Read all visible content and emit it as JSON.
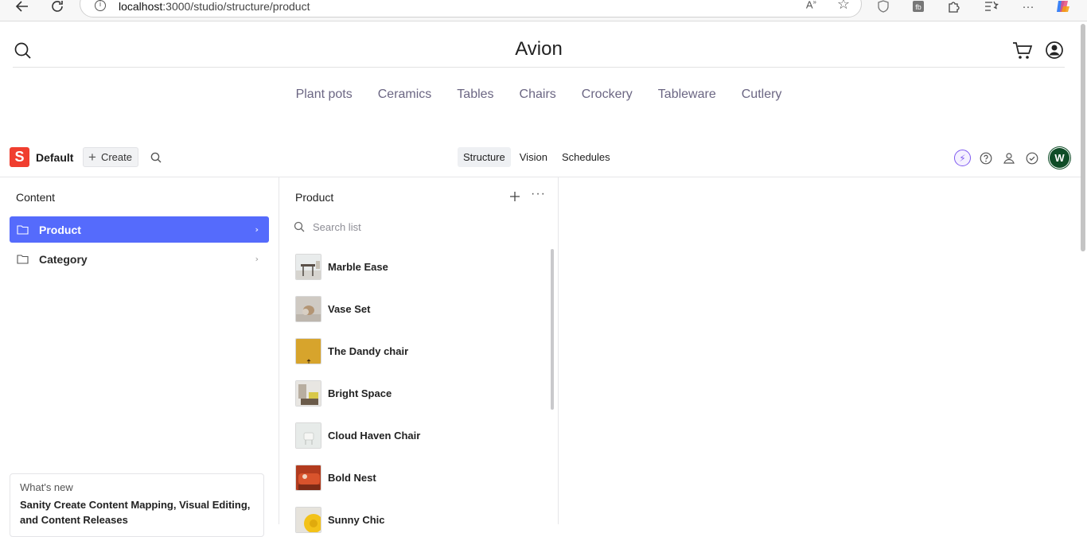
{
  "browser": {
    "url_host": "localhost",
    "url_rest": ":3000/studio/structure/product"
  },
  "site": {
    "title": "Avion",
    "categories": [
      "Plant pots",
      "Ceramics",
      "Tables",
      "Chairs",
      "Crockery",
      "Tableware",
      "Cutlery"
    ]
  },
  "studio": {
    "logo_letter": "S",
    "workspace": "Default",
    "create_label": "Create",
    "tools": [
      "Structure",
      "Vision",
      "Schedules"
    ],
    "active_tool": "Structure",
    "avatar_initial": "W",
    "colors": {
      "accent": "#556bfc",
      "brand": "#f03e2f",
      "avatar": "#0f4c27"
    }
  },
  "content_pane": {
    "title": "Content",
    "items": [
      {
        "label": "Product",
        "selected": true
      },
      {
        "label": "Category",
        "selected": false
      }
    ]
  },
  "whats_new": {
    "title": "What's new",
    "body": "Sanity Create Content Mapping, Visual Editing, and Content Releases"
  },
  "product_pane": {
    "title": "Product",
    "search_placeholder": "Search list",
    "items": [
      {
        "label": "Marble Ease",
        "thumb": "marble"
      },
      {
        "label": "Vase Set",
        "thumb": "vase"
      },
      {
        "label": "The Dandy chair",
        "thumb": "dandy"
      },
      {
        "label": "Bright Space",
        "thumb": "bright"
      },
      {
        "label": "Cloud Haven Chair",
        "thumb": "cloud"
      },
      {
        "label": "Bold Nest",
        "thumb": "bold"
      },
      {
        "label": "Sunny Chic",
        "thumb": "sunny"
      }
    ]
  }
}
